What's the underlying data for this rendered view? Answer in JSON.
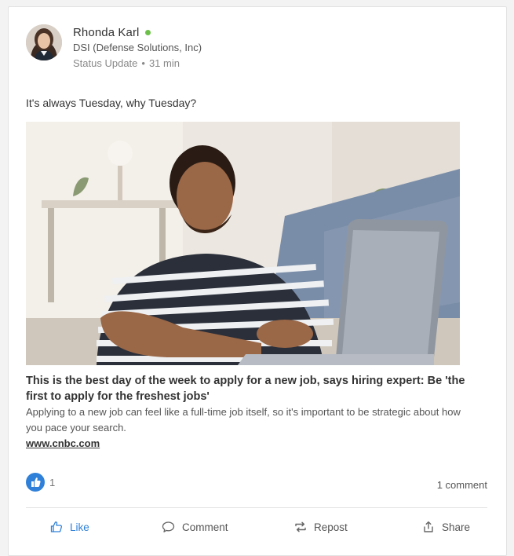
{
  "post": {
    "author": {
      "name": "Rhonda Karl",
      "organization": "DSI (Defense Solutions, Inc)",
      "status": "online"
    },
    "meta": {
      "type": "Status Update",
      "separator": "•",
      "time": "31 min"
    },
    "text": "It's always Tuesday, why Tuesday?",
    "preview": {
      "title": "This is the best day of the week to apply for a new job, says hiring expert: Be 'the first to apply for the freshest jobs'",
      "description": "Applying to a new job can feel like a full-time job itself, so it's important to be strategic about how you pace your search.",
      "link": "www.cnbc.com"
    },
    "reactions": {
      "like_count": "1",
      "comments": "1 comment"
    },
    "actions": {
      "like": "Like",
      "comment": "Comment",
      "repost": "Repost",
      "share": "Share"
    }
  },
  "colors": {
    "accent": "#2f80d8",
    "online": "#6cc04a"
  }
}
